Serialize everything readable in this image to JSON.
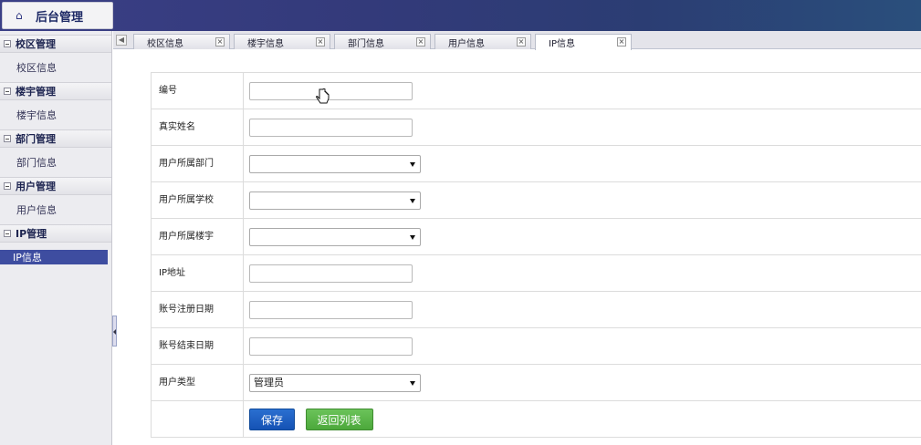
{
  "app": {
    "title": "后台管理"
  },
  "sidebar": {
    "groups": [
      {
        "title": "校区管理",
        "item": "校区信息"
      },
      {
        "title": "楼宇管理",
        "item": "楼宇信息"
      },
      {
        "title": "部门管理",
        "item": "部门信息"
      },
      {
        "title": "用户管理",
        "item": "用户信息"
      },
      {
        "title": "IP管理",
        "item": "IP信息"
      }
    ]
  },
  "tabs": [
    {
      "label": "校区信息"
    },
    {
      "label": "楼宇信息"
    },
    {
      "label": "部门信息"
    },
    {
      "label": "用户信息"
    },
    {
      "label": "IP信息"
    }
  ],
  "form": {
    "rows": [
      {
        "label": "编号",
        "type": "text",
        "value": ""
      },
      {
        "label": "真实姓名",
        "type": "text",
        "value": ""
      },
      {
        "label": "用户所属部门",
        "type": "select",
        "value": ""
      },
      {
        "label": "用户所属学校",
        "type": "select",
        "value": ""
      },
      {
        "label": "用户所属楼宇",
        "type": "select",
        "value": ""
      },
      {
        "label": "IP地址",
        "type": "text",
        "value": ""
      },
      {
        "label": "账号注册日期",
        "type": "text",
        "value": ""
      },
      {
        "label": "账号结束日期",
        "type": "text",
        "value": ""
      },
      {
        "label": "用户类型",
        "type": "select",
        "value": "管理员"
      }
    ],
    "save_label": "保存",
    "back_label": "返回列表"
  }
}
